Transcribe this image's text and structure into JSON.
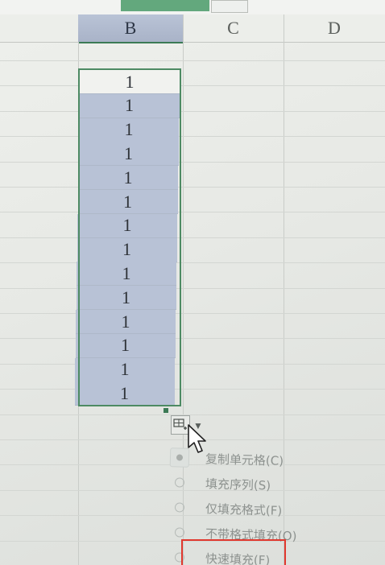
{
  "columns": {
    "b": "B",
    "c": "C",
    "d": "D"
  },
  "cells": [
    "1",
    "1",
    "1",
    "1",
    "1",
    "1",
    "1",
    "1",
    "1",
    "1",
    "1",
    "1",
    "1",
    "1"
  ],
  "autofill_menu": {
    "items": [
      {
        "label": "复制单元格(C)",
        "checked": true
      },
      {
        "label": "填充序列(S)",
        "checked": false
      },
      {
        "label": "仅填充格式(F)",
        "checked": false
      },
      {
        "label": "不带格式填充(O)",
        "checked": false
      },
      {
        "label": "快速填充(F)",
        "checked": false
      }
    ]
  },
  "colors": {
    "selection_border": "#4d8a63",
    "selected_fill": "#b8c2d6",
    "highlight_box": "#e0382e"
  }
}
